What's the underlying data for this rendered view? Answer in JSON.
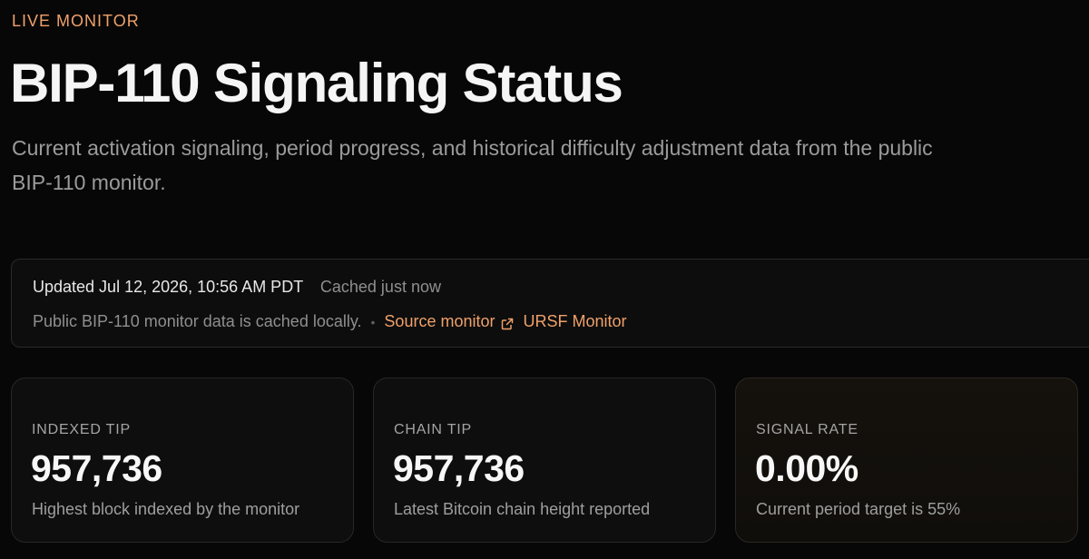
{
  "header": {
    "eyebrow": "LIVE MONITOR",
    "title": "BIP-110 Signaling Status",
    "subtitle": "Current activation signaling, period progress, and historical difficulty adjustment data from the public BIP-110 monitor."
  },
  "status": {
    "updated": "Updated Jul 12, 2026, 10:56 AM PDT",
    "cached": "Cached just now",
    "note": "Public BIP-110 monitor data is cached locally.",
    "separator": "•",
    "source_link": "Source monitor",
    "source_icon": "external-link-icon",
    "ursf_link": "URSF Monitor"
  },
  "cards": [
    {
      "label": "INDEXED TIP",
      "value": "957,736",
      "description": "Highest block indexed by the monitor"
    },
    {
      "label": "CHAIN TIP",
      "value": "957,736",
      "description": "Latest Bitcoin chain height reported"
    },
    {
      "label": "SIGNAL RATE",
      "value": "0.00%",
      "description": "Current period target is 55%"
    }
  ],
  "colors": {
    "accent": "#f0a16a",
    "background": "#070707"
  }
}
